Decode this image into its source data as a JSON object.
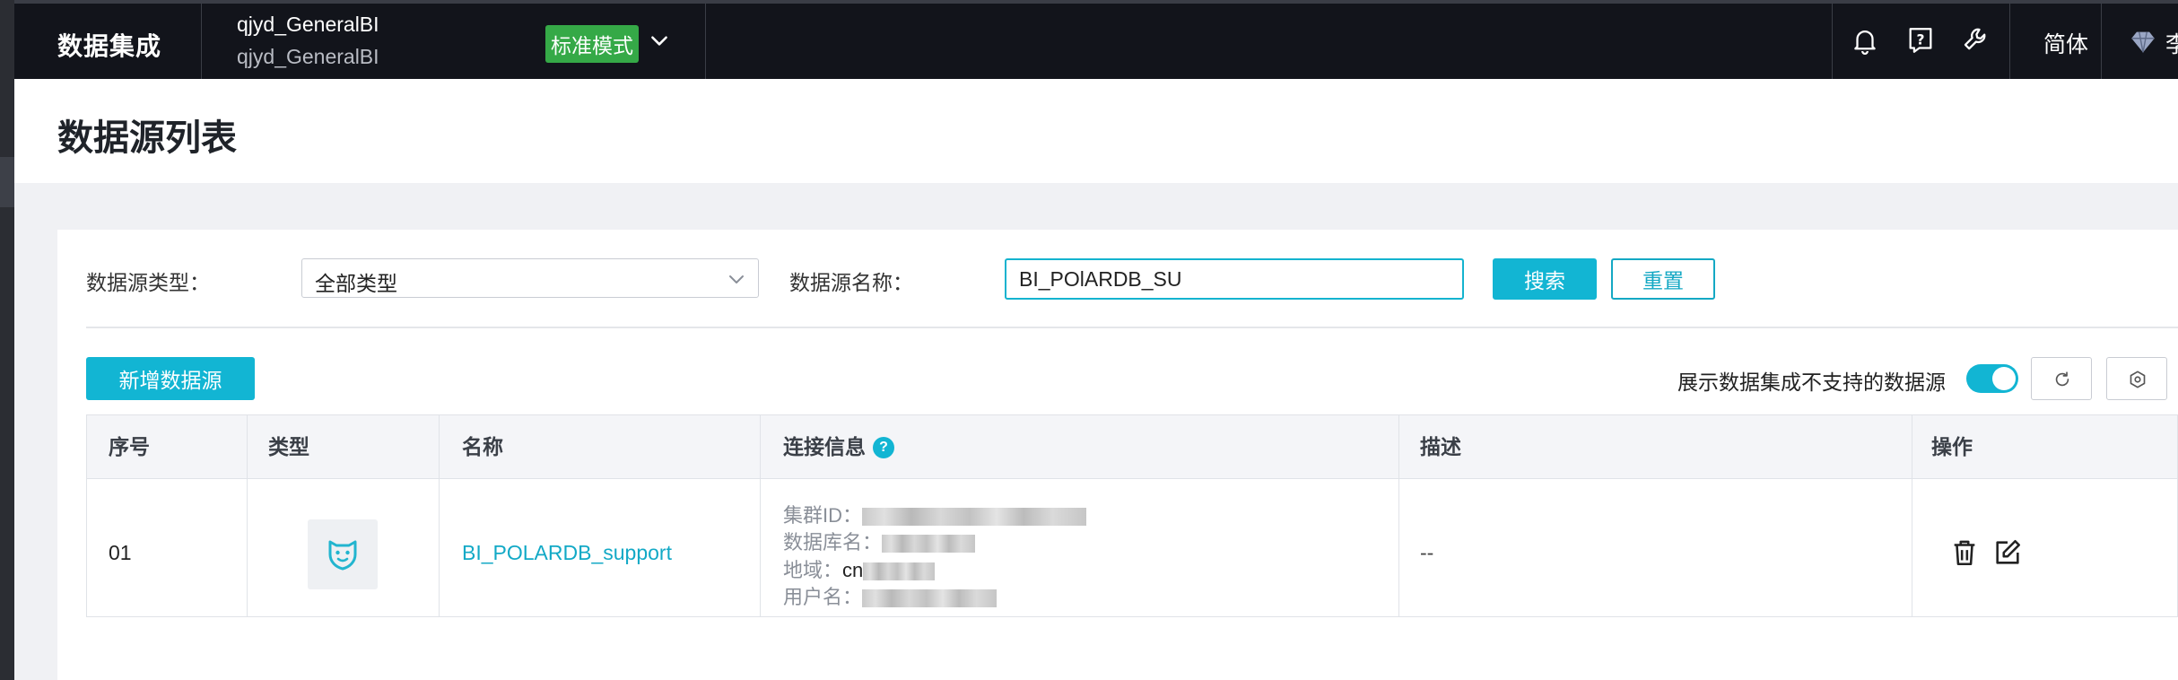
{
  "header": {
    "brand": "数据集成",
    "workspace_name": "qjyd_GeneralBI",
    "workspace_sub": "qjyd_GeneralBI",
    "mode": "标准模式",
    "language": "简体",
    "user_partial": "李"
  },
  "page": {
    "title": "数据源列表"
  },
  "filters": {
    "type_label": "数据源类型：",
    "type_value": "全部类型",
    "name_label": "数据源名称：",
    "name_value": "BI_POlARDB_SU",
    "search_label": "搜索",
    "reset_label": "重置"
  },
  "toolbar": {
    "add_label": "新增数据源",
    "toggle_label": "展示数据集成不支持的数据源",
    "toggle_on": true
  },
  "table": {
    "columns": [
      "序号",
      "类型",
      "名称",
      "连接信息",
      "描述",
      "操作"
    ],
    "rows": [
      {
        "index": "01",
        "type_icon": "polardb-icon",
        "name": "BI_POLARDB_support",
        "conn": {
          "cluster_label": "集群ID：",
          "db_label": "数据库名：",
          "region_label": "地域：",
          "region_value": "cn",
          "user_label": "用户名："
        },
        "desc": "--"
      }
    ]
  },
  "colors": {
    "accent": "#12b5d3",
    "mode_badge": "#35a947",
    "topbar": "#12141b"
  }
}
